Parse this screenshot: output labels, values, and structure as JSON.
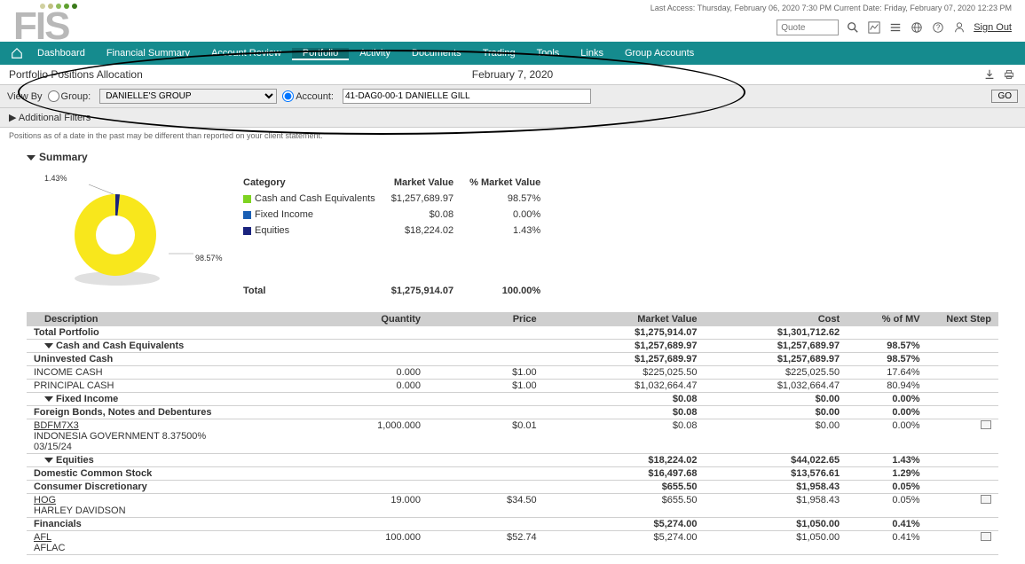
{
  "status": {
    "last_access_label": "Last Access: Thursday, February 06, 2020 7:30 PM Current Date: Friday, February 07, 2020 12:23 PM"
  },
  "search": {
    "placeholder": "Quote"
  },
  "signout": "Sign Out",
  "nav": {
    "items": [
      "Dashboard",
      "Financial Summary",
      "Account Review",
      "Portfolio",
      "Activity",
      "Documents",
      "Trading",
      "Tools",
      "Links",
      "Group Accounts"
    ],
    "active": "Portfolio"
  },
  "page": {
    "title": "Portfolio Positions Allocation",
    "date": "February 7, 2020"
  },
  "filter": {
    "view_by_label": "View By",
    "group_label": "Group:",
    "group_value": "DANIELLE'S GROUP",
    "account_label": "Account:",
    "account_value": "41-DAG0-00-1 DANIELLE GILL",
    "go": "GO",
    "additional": "Additional Filters"
  },
  "disclaimer": "Positions as of a date in the past may be different than reported on your client statement.",
  "summary": {
    "heading": "Summary",
    "cols": {
      "category": "Category",
      "mv": "Market Value",
      "pctmv": "% Market Value"
    },
    "rows": [
      {
        "cat": "Cash and Cash Equivalents",
        "mv": "$1,257,689.97",
        "pct": "98.57%",
        "sw": "sw-cash"
      },
      {
        "cat": "Fixed Income",
        "mv": "$0.08",
        "pct": "0.00%",
        "sw": "sw-fixed"
      },
      {
        "cat": "Equities",
        "mv": "$18,224.02",
        "pct": "1.43%",
        "sw": "sw-eq"
      }
    ],
    "total": {
      "label": "Total",
      "mv": "$1,275,914.07",
      "pct": "100.00%"
    },
    "donut_labels": {
      "small": "1.43%",
      "large": "98.57%"
    }
  },
  "chart_data": {
    "type": "pie",
    "title": "",
    "categories": [
      "Cash and Cash Equivalents",
      "Fixed Income",
      "Equities"
    ],
    "values": [
      98.57,
      0.0,
      1.43
    ],
    "colors": [
      "#f8e71c",
      "#1a5fb4",
      "#1a237e"
    ]
  },
  "grid": {
    "cols": {
      "desc": "Description",
      "qty": "Quantity",
      "price": "Price",
      "mv": "Market Value",
      "cost": "Cost",
      "pct": "% of MV",
      "next": "Next Step"
    },
    "rows": [
      {
        "type": "bold",
        "desc": "Total Portfolio",
        "mv": "$1,275,914.07",
        "cost": "$1,301,712.62"
      },
      {
        "type": "section",
        "desc": "Cash and Cash Equivalents",
        "mv": "$1,257,689.97",
        "cost": "$1,257,689.97",
        "pct": "98.57%"
      },
      {
        "type": "bold",
        "indent": 1,
        "desc": "Uninvested Cash",
        "mv": "$1,257,689.97",
        "cost": "$1,257,689.97",
        "pct": "98.57%"
      },
      {
        "indent": 2,
        "desc": "INCOME CASH",
        "qty": "0.000",
        "price": "$1.00",
        "mv": "$225,025.50",
        "cost": "$225,025.50",
        "pct": "17.64%"
      },
      {
        "indent": 2,
        "desc": "PRINCIPAL CASH",
        "qty": "0.000",
        "price": "$1.00",
        "mv": "$1,032,664.47",
        "cost": "$1,032,664.47",
        "pct": "80.94%"
      },
      {
        "type": "section",
        "desc": "Fixed Income",
        "mv": "$0.08",
        "cost": "$0.00",
        "pct": "0.00%"
      },
      {
        "type": "bold",
        "indent": 1,
        "desc": "Foreign Bonds, Notes and Debentures",
        "mv": "$0.08",
        "cost": "$0.00",
        "pct": "0.00%"
      },
      {
        "indent": 2,
        "multiline": [
          "BDFM7X3",
          "INDONESIA GOVERNMENT 8.37500%",
          "03/15/24"
        ],
        "qty": "1,000.000",
        "price": "$0.01",
        "mv": "$0.08",
        "cost": "$0.00",
        "pct": "0.00%",
        "note": true,
        "ticker": true
      },
      {
        "type": "section",
        "desc": "Equities",
        "mv": "$18,224.02",
        "cost": "$44,022.65",
        "pct": "1.43%"
      },
      {
        "type": "bold",
        "indent": 1,
        "desc": "Domestic Common Stock",
        "mv": "$16,497.68",
        "cost": "$13,576.61",
        "pct": "1.29%"
      },
      {
        "type": "bold",
        "indent": 2,
        "desc": "Consumer Discretionary",
        "mv": "$655.50",
        "cost": "$1,958.43",
        "pct": "0.05%"
      },
      {
        "indent": 3,
        "multiline": [
          "HOG",
          "HARLEY DAVIDSON"
        ],
        "qty": "19.000",
        "price": "$34.50",
        "mv": "$655.50",
        "cost": "$1,958.43",
        "pct": "0.05%",
        "note": true,
        "ticker": true
      },
      {
        "type": "bold",
        "indent": 2,
        "desc": "Financials",
        "mv": "$5,274.00",
        "cost": "$1,050.00",
        "pct": "0.41%"
      },
      {
        "indent": 3,
        "multiline": [
          "AFL",
          "AFLAC"
        ],
        "qty": "100.000",
        "price": "$52.74",
        "mv": "$5,274.00",
        "cost": "$1,050.00",
        "pct": "0.41%",
        "note": true,
        "ticker": true
      }
    ]
  }
}
